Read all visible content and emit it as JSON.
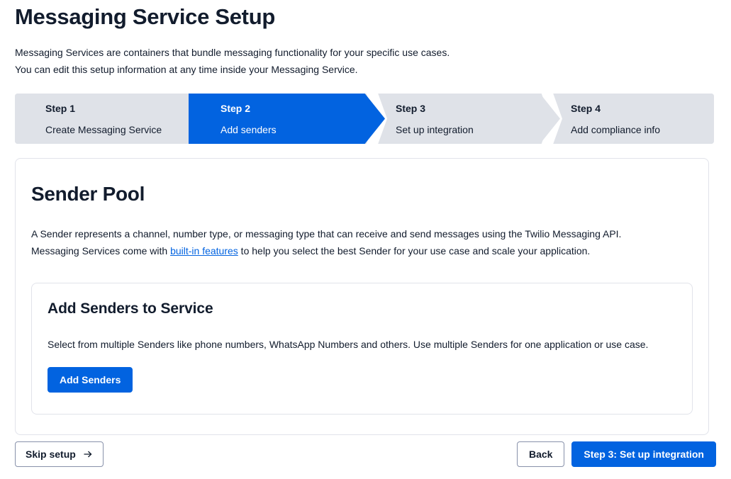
{
  "header": {
    "title": "Messaging Service Setup",
    "intro_line_1": "Messaging Services are containers that bundle messaging functionality for your specific use cases.",
    "intro_line_2": "You can edit this setup information at any time inside your Messaging Service."
  },
  "stepper": {
    "active_index": 1,
    "steps": [
      {
        "number": "Step 1",
        "label": "Create Messaging Service",
        "active": false
      },
      {
        "number": "Step 2",
        "label": "Add senders",
        "active": true
      },
      {
        "number": "Step 3",
        "label": "Set up integration",
        "active": false
      },
      {
        "number": "Step 4",
        "label": "Add compliance info",
        "active": false
      }
    ]
  },
  "sender_pool": {
    "title": "Sender Pool",
    "desc_line_1_before": "A Sender represents a channel, number type, or messaging type that can receive and send messages using the Twilio Messaging API.",
    "desc_line_2_before": "Messaging Services come with ",
    "desc_link": "built-in features",
    "desc_line_2_after": " to help you select the best Sender for your use case and scale your application."
  },
  "add_senders_card": {
    "title": "Add Senders to Service",
    "description": "Select from multiple Senders like phone numbers, WhatsApp Numbers and others. Use multiple Senders for one application or use case.",
    "button_label": "Add Senders"
  },
  "footer": {
    "skip_label": "Skip setup",
    "skip_icon": "arrow-right-icon",
    "back_label": "Back",
    "next_label": "Step 3: Set up integration"
  },
  "colors": {
    "accent_blue": "#0263e0",
    "step_gray": "#dfe2e8",
    "text_dark": "#121c2d",
    "border": "#e1e3ea",
    "secondary_border": "#8891aa"
  }
}
